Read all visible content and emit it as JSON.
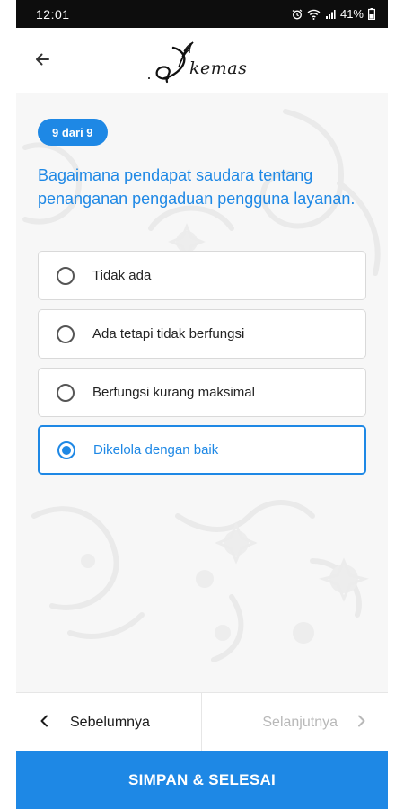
{
  "status_bar": {
    "time": "12:01",
    "battery": "41%",
    "icons": [
      "alarm-icon",
      "wifi-icon",
      "signal-icon",
      "battery-icon"
    ]
  },
  "header": {
    "back_icon": "arrow-left-icon",
    "logo_text": "kemas",
    "logo_icon": "quill-feather-icon"
  },
  "question": {
    "step": "9 dari 9",
    "text": "Bagaimana pendapat saudara tentang penanganan pengaduan pengguna layanan.",
    "options": [
      {
        "label": "Tidak ada",
        "selected": false
      },
      {
        "label": "Ada tetapi tidak berfungsi",
        "selected": false
      },
      {
        "label": "Berfungsi kurang maksimal",
        "selected": false
      },
      {
        "label": "Dikelola dengan baik",
        "selected": true
      }
    ]
  },
  "navigation": {
    "prev_label": "Sebelumnya",
    "prev_icon": "chevron-left-icon",
    "next_label": "Selanjutnya",
    "next_icon": "chevron-right-icon",
    "next_enabled": false
  },
  "finish_button": {
    "label": "SIMPAN & SELESAI"
  },
  "colors": {
    "accent": "#1e88e5",
    "status_bar": "#0d0d0d",
    "disabled_text": "#b8b8b8"
  }
}
